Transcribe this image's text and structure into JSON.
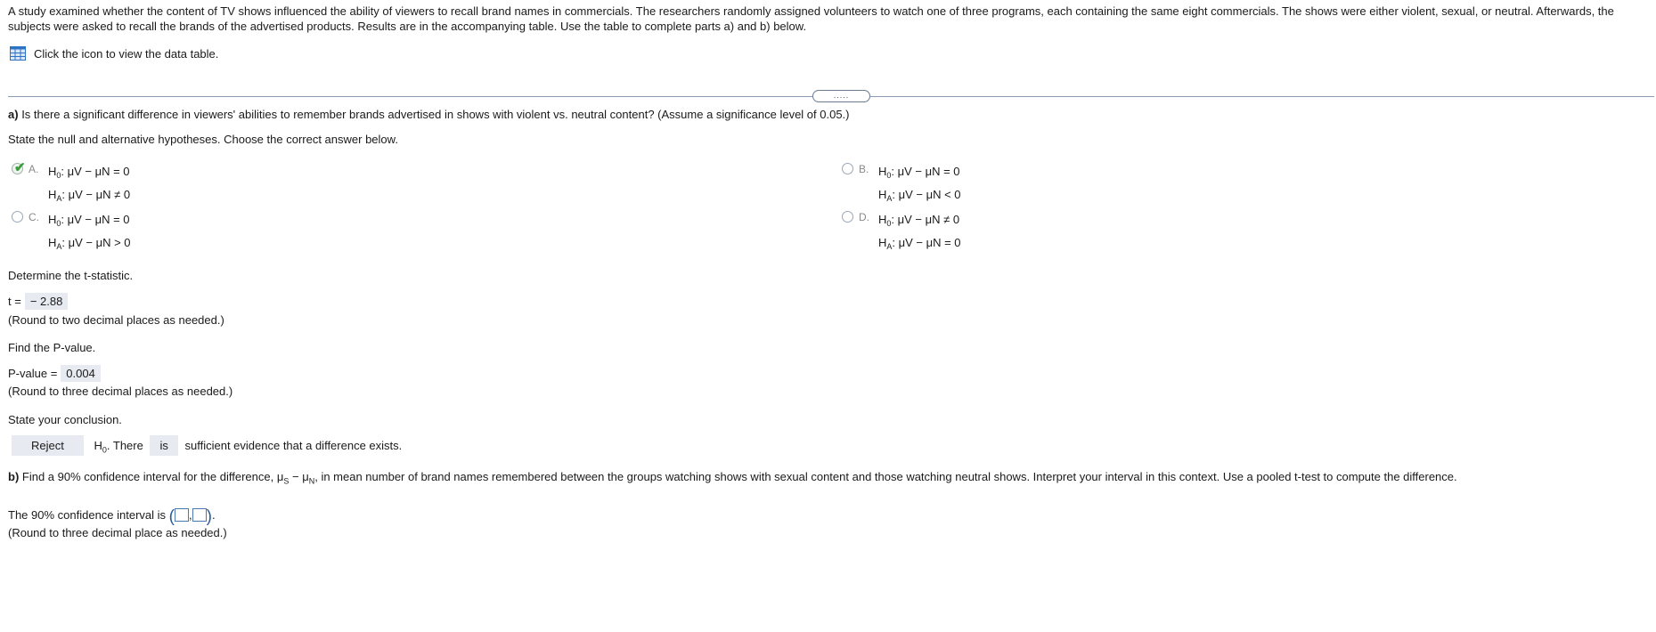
{
  "intro": "A study examined whether the content of TV shows influenced the ability of viewers to recall brand names in commercials. The researchers randomly assigned volunteers to watch one of three programs, each containing the same eight commercials. The shows were either violent, sexual, or neutral. Afterwards, the subjects were asked to recall the brands of the advertised products. Results are in the accompanying table. Use the table to complete parts a) and b) below.",
  "table_link": "Click the icon to view the data table.",
  "more_button": ".....",
  "part_a": {
    "label": "a)",
    "question": "Is there a significant difference in viewers' abilities to remember brands advertised in shows with violent vs. neutral content? (Assume a significance level of 0.05.)",
    "instruction": "State the null and alternative hypotheses. Choose the correct answer below.",
    "options": [
      {
        "letter": "A.",
        "h0": "μV − μN = 0",
        "ha": "μV − μN ≠ 0",
        "selected": true
      },
      {
        "letter": "B.",
        "h0": "μV − μN = 0",
        "ha": "μV − μN < 0",
        "selected": false
      },
      {
        "letter": "C.",
        "h0": "μV − μN = 0",
        "ha": "μV − μN > 0",
        "selected": false
      },
      {
        "letter": "D.",
        "h0": "μV − μN ≠ 0",
        "ha": "μV − μN = 0",
        "selected": false
      }
    ],
    "t_prompt": "Determine the t-statistic.",
    "t_label": "t =",
    "t_value": "− 2.88",
    "t_hint": "(Round to two decimal places as needed.)",
    "p_prompt": "Find the P-value.",
    "p_label": "P-value =",
    "p_value": "0.004",
    "p_hint": "(Round to three decimal places as needed.)",
    "conclusion_prompt": "State your conclusion.",
    "conclusion_decision": "Reject",
    "conclusion_mid": ". There",
    "conclusion_is": "is",
    "conclusion_end": "sufficient evidence that a difference exists."
  },
  "part_b": {
    "label": "b)",
    "question_pre": "Find a 90% confidence interval for the difference,",
    "question_post": "in mean number of brand names remembered between the groups watching shows with sexual content and those watching neutral shows. Interpret your interval in this context. Use a pooled t-test to compute the difference.",
    "ci_label": "The 90% confidence interval is",
    "ci_hint": "(Round to three decimal place as needed.)"
  },
  "colors": {
    "accent": "#2a5c9a",
    "answer_bg": "#e7ebf1",
    "check": "#3a9b3a"
  }
}
